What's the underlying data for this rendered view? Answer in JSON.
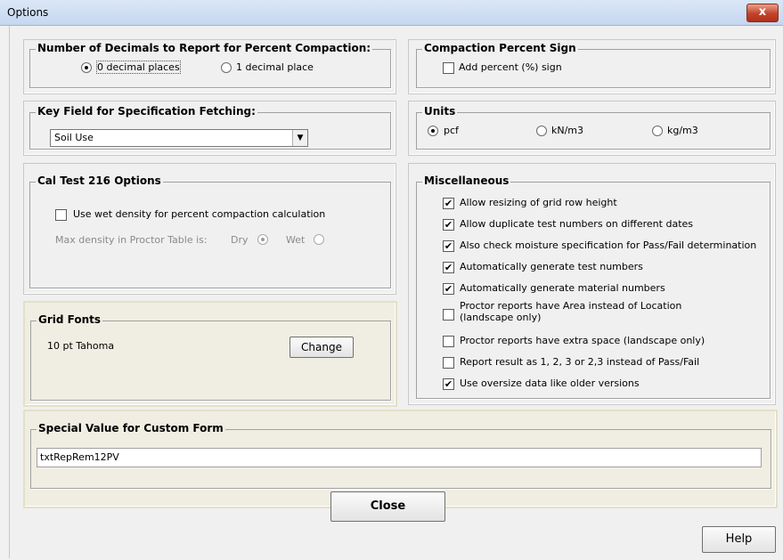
{
  "window": {
    "title": "Options",
    "close_glyph": "x"
  },
  "decimals": {
    "legend": "Number of Decimals to Report for Percent Compaction:",
    "option0": "0 decimal places",
    "option1": "1 decimal place",
    "selected": "0 decimal places"
  },
  "percent_sign": {
    "legend": "Compaction Percent Sign",
    "checkbox_label": "Add percent (%) sign",
    "checked": false
  },
  "key_field": {
    "legend": "Key Field for Specification Fetching:",
    "value": "Soil Use",
    "arrow": "▼"
  },
  "units": {
    "legend": "Units",
    "options": [
      "pcf",
      "kN/m3",
      "kg/m3"
    ],
    "selected": "pcf"
  },
  "caltest": {
    "legend": "Cal Test 216 Options",
    "checkbox_label": "Use wet density for percent compaction calculation",
    "checked": false,
    "max_density_label": "Max density in Proctor Table is:",
    "dry_label": "Dry",
    "wet_label": "Wet",
    "selected": "Dry"
  },
  "misc": {
    "legend": "Miscellaneous",
    "items": [
      {
        "label": "Allow resizing of grid row height",
        "checked": true
      },
      {
        "label": "Allow duplicate test numbers on different dates",
        "checked": true
      },
      {
        "label": "Also check moisture specification for Pass/Fail determination",
        "checked": true
      },
      {
        "label": "Automatically generate test numbers",
        "checked": true
      },
      {
        "label": "Automatically generate material numbers",
        "checked": true
      },
      {
        "label": "Proctor reports have Area instead of Location",
        "label2": "(landscape only)",
        "checked": false
      },
      {
        "label": "Proctor reports have extra space (landscape only)",
        "checked": false
      },
      {
        "label": "Report result as 1, 2, 3 or 2,3 instead of Pass/Fail",
        "checked": false
      },
      {
        "label": "Use oversize data like older versions",
        "checked": true
      }
    ],
    "check_glyph": "✔"
  },
  "grid_fonts": {
    "legend": "Grid Fonts",
    "font_text": "10 pt  Tahoma",
    "change_button": "Change"
  },
  "special_value": {
    "legend": "Special Value for Custom Form",
    "value": "txtRepRem12PV"
  },
  "footer": {
    "close_button": "Close",
    "help_button": "Help"
  }
}
